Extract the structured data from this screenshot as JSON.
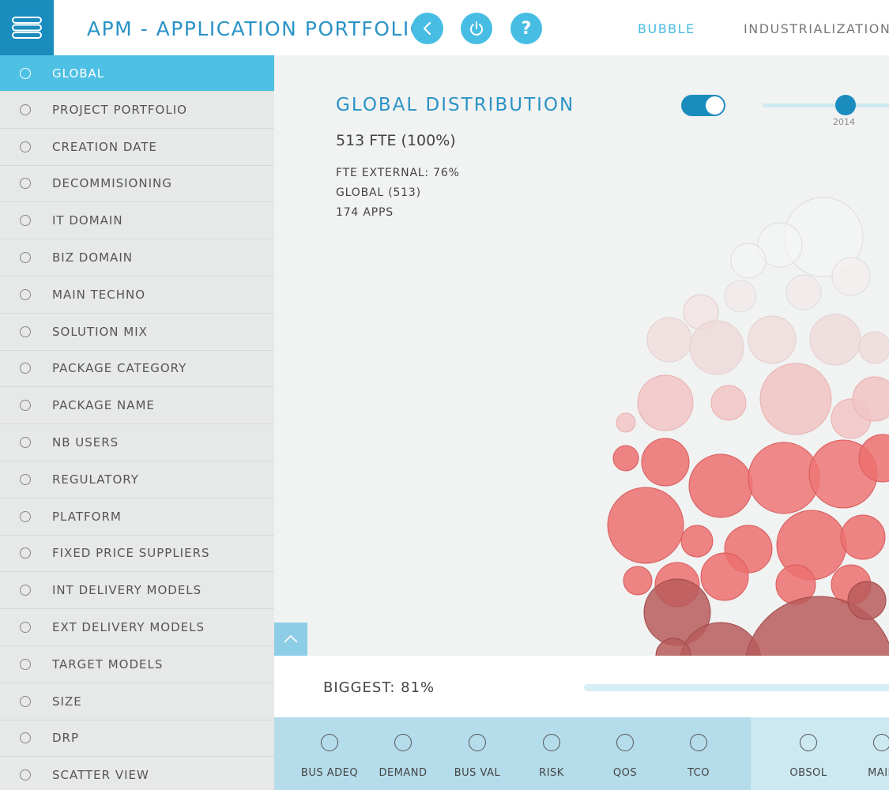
{
  "header": {
    "title": "APM - APPLICATION PORTFOLIO",
    "menu_icon": "hamburger-menu-icon",
    "buttons": [
      "back-icon",
      "power-icon",
      "help-icon"
    ],
    "help_glyph": "?",
    "nav": {
      "bubble": "BUBBLE",
      "industrialization": "INDUSTRIALIZATION"
    },
    "colors": {
      "brand": "#1b8cbe",
      "accent": "#47bde4"
    }
  },
  "sidebar": {
    "items": [
      {
        "label": "GLOBAL",
        "active": true
      },
      {
        "label": "PROJECT PORTFOLIO"
      },
      {
        "label": "CREATION DATE"
      },
      {
        "label": "DECOMMISIONING"
      },
      {
        "label": "IT DOMAIN"
      },
      {
        "label": "BIZ DOMAIN"
      },
      {
        "label": "MAIN TECHNO"
      },
      {
        "label": "SOLUTION MIX"
      },
      {
        "label": "PACKAGE CATEGORY"
      },
      {
        "label": "PACKAGE NAME"
      },
      {
        "label": "NB USERS"
      },
      {
        "label": "REGULATORY"
      },
      {
        "label": "PLATFORM"
      },
      {
        "label": "FIXED PRICE SUPPLIERS"
      },
      {
        "label": "INT DELIVERY MODELS"
      },
      {
        "label": "EXT DELIVERY MODELS"
      },
      {
        "label": "TARGET MODELS"
      },
      {
        "label": "SIZE"
      },
      {
        "label": "DRP"
      },
      {
        "label": "SCATTER VIEW"
      }
    ]
  },
  "main": {
    "title": "GLOBAL DISTRIBUTION",
    "fte": "513 FTE (100%)",
    "fte_external": "FTE EXTERNAL: 76%",
    "global": "GLOBAL (513)",
    "apps": "174 APPS",
    "toggle_on": true,
    "year": "2014"
  },
  "bottom": {
    "biggest": "BIGGEST: 81%",
    "criteria": [
      {
        "label": "BUS ADEQ"
      },
      {
        "label": "DEMAND"
      },
      {
        "label": "BUS VAL"
      },
      {
        "label": "RISK"
      },
      {
        "label": "QOS"
      },
      {
        "label": "TCO"
      },
      {
        "label": "OBSOL"
      },
      {
        "label": "MAIN"
      }
    ]
  }
}
